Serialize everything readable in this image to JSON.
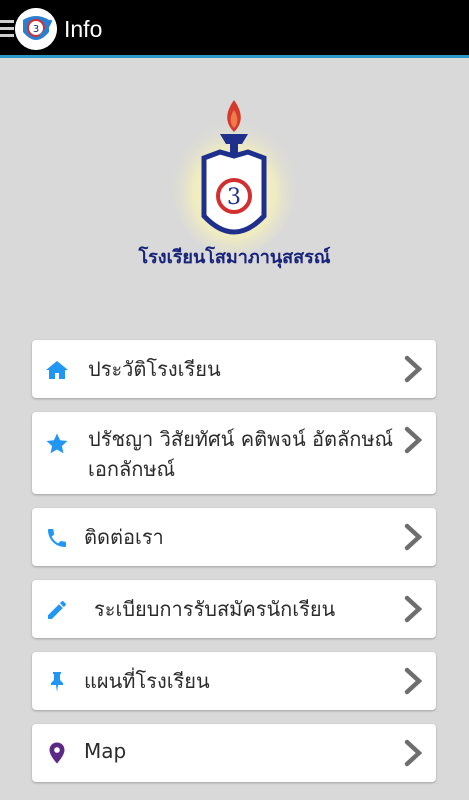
{
  "app_bar": {
    "title": "Info"
  },
  "header": {
    "school_name": "โรงเรียนโสมาภานุสสรณ์",
    "emblem_number": "3"
  },
  "menu": {
    "items": [
      {
        "label": "ประวัติโรงเรียน",
        "icon": "home-icon"
      },
      {
        "label": "ปรัชญา วิสัยทัศน์  คติพจน์ อัตลักษณ์  เอกลักษณ์",
        "icon": "star-icon"
      },
      {
        "label": "ติดต่อเรา",
        "icon": "phone-icon"
      },
      {
        "label": "ระเบียบการรับสมัครนักเรียน",
        "icon": "pencil-icon"
      },
      {
        "label": "แผนที่โรงเรียน",
        "icon": "pin-icon"
      },
      {
        "label": "Map",
        "icon": "map-marker-icon"
      }
    ]
  },
  "colors": {
    "app_bar_bg": "#000000",
    "app_bar_accent": "#2b98c9",
    "page_bg": "#d9d9d9",
    "icon_blue": "#2196f3",
    "icon_purple": "#5b2a86",
    "school_name_color": "#18237a",
    "chevron": "#6e6e6e"
  }
}
